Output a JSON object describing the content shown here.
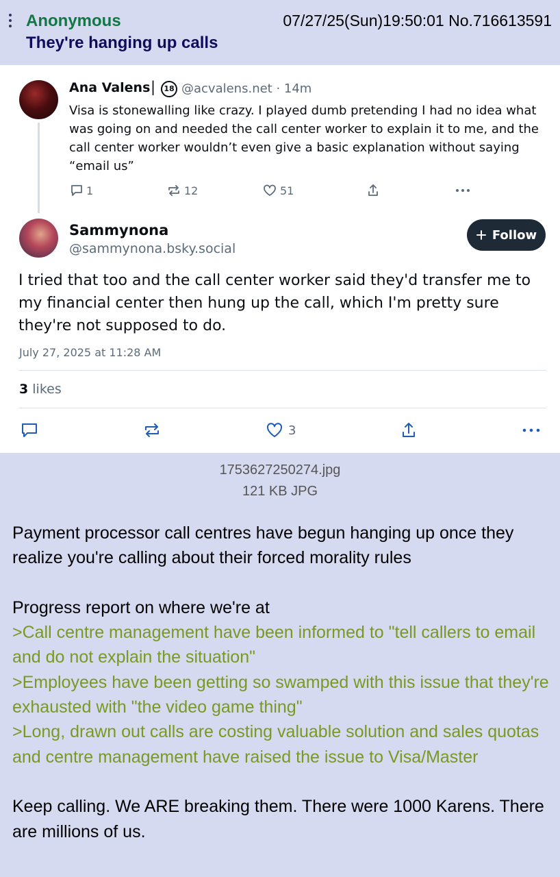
{
  "post": {
    "name": "Anonymous",
    "date_time": "07/27/25(Sun)19:50:01",
    "number": "No.716613591",
    "subject": "They're hanging up calls"
  },
  "embed": {
    "quoted": {
      "display_name": "Ana Valens",
      "separator": "|",
      "badge": "18",
      "handle_time": "@acvalens.net · 14m",
      "text": "Visa is stonewalling like crazy. I played dumb pretending I had no idea what was going on and needed the call center worker to explain it to me, and the call center worker wouldn’t even give a basic explanation without saying “email us”",
      "replies": "1",
      "reposts": "12",
      "likes": "51"
    },
    "main": {
      "display_name": "Sammynona",
      "handle": "@sammynona.bsky.social",
      "follow_label": "Follow",
      "text": "I tried that too and the call center worker said they'd transfer me to my financial center then hung up the call, which I'm pretty sure they're not supposed to do.",
      "date": "July 27, 2025 at 11:28 AM",
      "likes_count": "3",
      "likes_label": "likes",
      "like_action_count": "3"
    },
    "icons": [
      "reply-icon",
      "repost-icon",
      "heart-icon",
      "share-icon",
      "more-icon"
    ]
  },
  "file": {
    "name": "1753627250274.jpg",
    "meta": "121 KB JPG"
  },
  "body": {
    "p1": "Payment processor call centres have begun hanging up once they realize you're calling about their forced morality rules",
    "p2": "Progress report on where we're at",
    "green1": ">Call centre management have been informed to \"tell callers to email and do not explain the situation\"",
    "green2": ">Employees have been getting so swamped with this issue that they're exhausted with \"the video game thing\"",
    "green3": ">Long, drawn out calls are costing valuable solution and sales quotas and centre management have raised the issue to Visa/Master",
    "p3": "Keep calling. We ARE breaking them. There were 1000 Karens. There are millions of us."
  },
  "colors": {
    "board_bg": "#d6daf0",
    "name_green": "#117743",
    "subject_blue": "#0f0c5d",
    "greentext": "#789922"
  }
}
